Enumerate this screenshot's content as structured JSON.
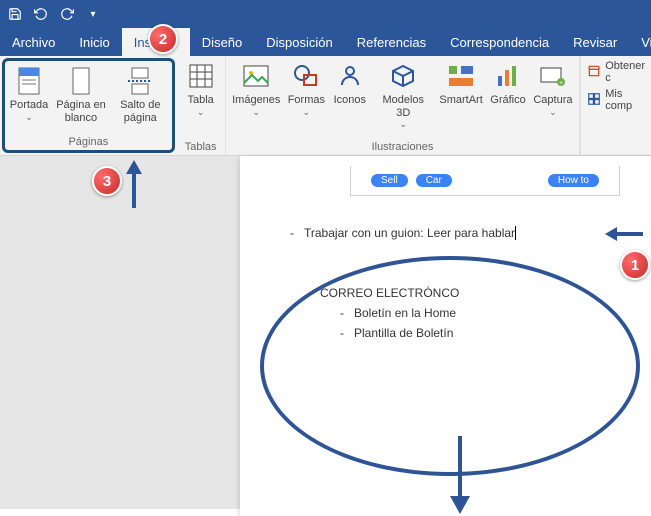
{
  "colors": {
    "brand": "#2b579a",
    "accent": "#1f4e79",
    "pill": "#3b82f6"
  },
  "tabs": {
    "file": "Archivo",
    "home": "Inicio",
    "insert": "Insertar",
    "design": "Diseño",
    "layout": "Disposición",
    "references": "Referencias",
    "mailings": "Correspondencia",
    "review": "Revisar",
    "view": "Vista"
  },
  "ribbon": {
    "pages": {
      "cover": "Portada",
      "blank": "Página en blanco",
      "break": "Salto de página",
      "group": "Páginas"
    },
    "tables": {
      "table": "Tabla",
      "group": "Tablas"
    },
    "illus": {
      "images": "Imágenes",
      "shapes": "Formas",
      "icons": "Iconos",
      "models": "Modelos 3D",
      "smartart": "SmartArt",
      "chart": "Gráfico",
      "screenshot": "Captura",
      "group": "Ilustraciones"
    },
    "right": {
      "get": "Obtener c",
      "my": "Mis comp"
    }
  },
  "document": {
    "pills": {
      "sell": "Sell",
      "car": "Car",
      "howto": "How to"
    },
    "line1": "Trabajar con un guion: Leer para hablar",
    "section": "CORREO ELECTRÓNCO",
    "bullet1": "Boletín en la Home",
    "bullet2": "Plantilla de Boletín"
  },
  "callouts": {
    "one": "1",
    "two": "2",
    "three": "3"
  }
}
